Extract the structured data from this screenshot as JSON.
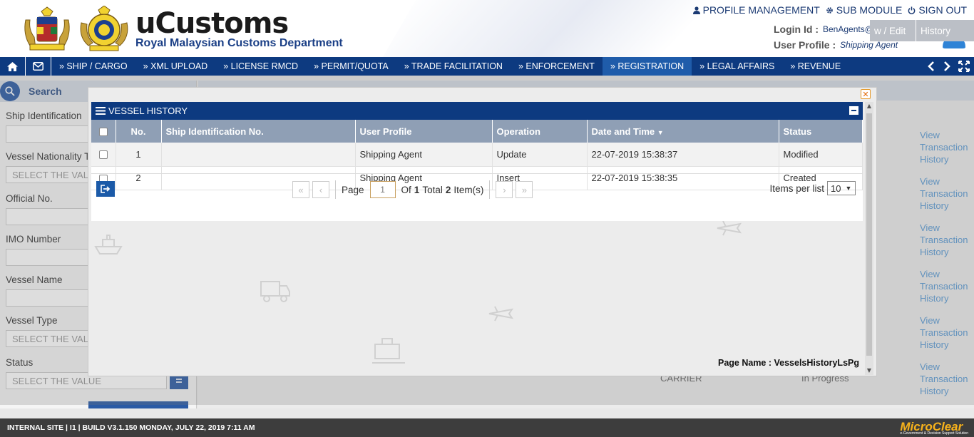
{
  "header": {
    "title": "uCustoms",
    "subtitle": "Royal Malaysian Customs Department",
    "links": [
      "PROFILE MANAGEMENT",
      "SUB MODULE",
      "SIGN OUT"
    ],
    "login_label": "Login Id :",
    "login_value": "BenAgents@PKFZ.com.my",
    "profile_label": "User Profile :",
    "profile_value": "Shipping Agent"
  },
  "nav": {
    "items": [
      "» SHIP / CARGO",
      "» XML UPLOAD",
      "» LICENSE RMCD",
      "» PERMIT/QUOTA",
      "» TRADE FACILITATION",
      "» ENFORCEMENT",
      "» REGISTRATION",
      "» LEGAL AFFAIRS",
      "» REVENUE"
    ],
    "active": "» REGISTRATION"
  },
  "search": {
    "title": "Search",
    "fields": [
      {
        "label": "Ship Identification",
        "value": ""
      },
      {
        "label": "Vessel Nationality T",
        "value": "SELECT THE VALU"
      },
      {
        "label": "Official No.",
        "value": ""
      },
      {
        "label": "IMO Number",
        "value": ""
      },
      {
        "label": "Vessel Name",
        "value": ""
      },
      {
        "label": "Vessel Type",
        "value": "SELECT THE VALU"
      },
      {
        "label": "Status",
        "value": "SELECT THE VALUE"
      }
    ]
  },
  "background": {
    "col_view_edit": "w / Edit",
    "col_history": "History",
    "history_link": [
      "View",
      "Transaction",
      "History"
    ],
    "carrier_text": "CARRIER",
    "progress_text": "In Progress"
  },
  "modal": {
    "title": "VESSEL HISTORY",
    "columns": [
      "No.",
      "Ship Identification No.",
      "User Profile",
      "Operation",
      "Date and Time",
      "Status"
    ],
    "rows": [
      {
        "no": "1",
        "ship_id": "",
        "profile": "Shipping Agent",
        "operation": "Update",
        "datetime": "22-07-2019 15:38:37",
        "status": "Modified"
      },
      {
        "no": "2",
        "ship_id": "",
        "profile": "Shipping Agent",
        "operation": "Insert",
        "datetime": "22-07-2019 15:38:35",
        "status": "Created"
      }
    ],
    "pager": {
      "page_label": "Page",
      "page_value": "1",
      "of_label": "Of",
      "total_pages": "1",
      "total_label": "Total",
      "total_items": "2",
      "items_label": "Item(s)",
      "ipl_label": "Items per list",
      "ipl_value": "10"
    },
    "page_name": "Page Name : VesselsHistoryLsPg"
  },
  "footer": {
    "text": "INTERNAL SITE | I1 | BUILD V3.1.150 MONDAY, JULY 22, 2019 7:11 AM",
    "brand": "MicroClear"
  },
  "colors": {
    "nav": "#0d3a80",
    "grid_header": "#8f9fb5",
    "link": "#5b9bd5",
    "accent": "#f7b21b"
  }
}
